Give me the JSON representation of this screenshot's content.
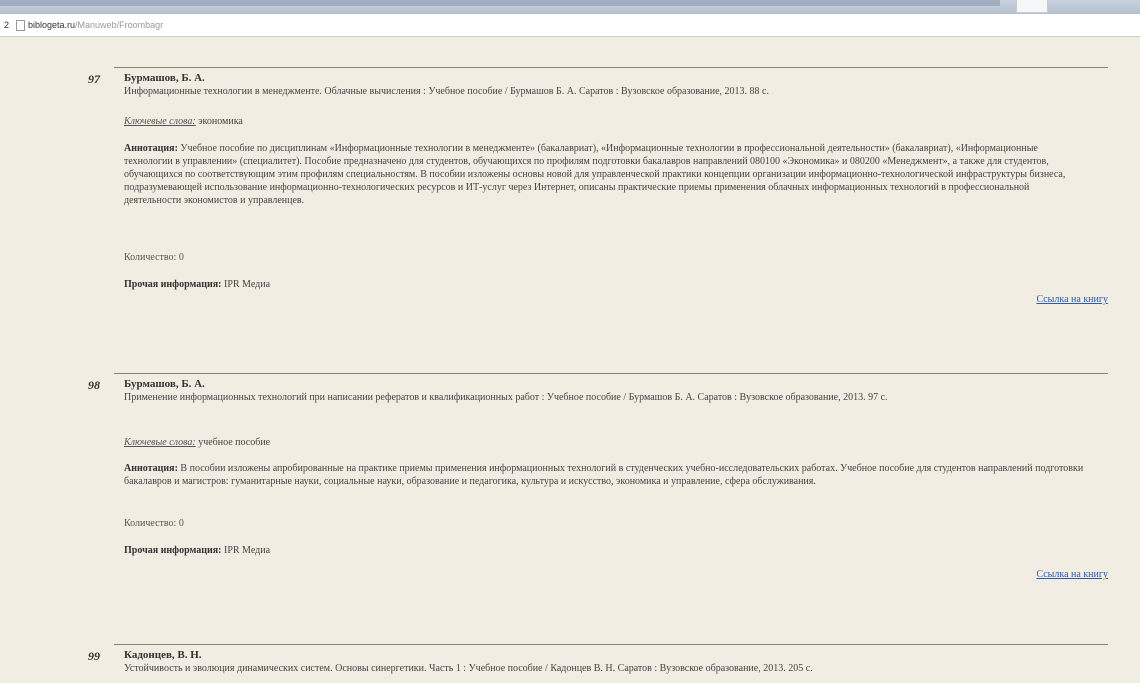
{
  "browser": {
    "tab_number": "2",
    "url_host": "biblogeta.ru",
    "url_path": "/Manuweb/Froombagr"
  },
  "entries": [
    {
      "number": "97",
      "author": "Бурмашов, Б. А.",
      "description": "Информационные технологии в менеджменте. Облачные вычисления : Учебное пособие / Бурмашов Б. А. Саратов : Вузовское образование, 2013. 88 с.",
      "keywords_label": "Ключевые слова:",
      "keywords": "экономика",
      "annotation_label": "Аннотация:",
      "annotation": "Учебное пособие по дисциплинам «Информационные технологии в менеджменте» (бакалавриат), «Информационные технологии в профессиональной деятельности» (бакалавриат), «Информационные технологии в управлении» (специалитет). Пособие предназначено для студентов, обучающихся по профилям подготовки бакалавров направлений 080100 «Экономика» и 080200 «Менеджмент», а также для студентов, обучающихся по соответствующим этим профилям специальностям. В пособии изложены основы новой для управленческой практики концепции организации информационно-технологической инфраструктуры бизнеса, подразумевающей использование информационно-технологических ресурсов и ИТ-услуг через Интернет, описаны практические приемы применения облачных информационных технологий в профессиональной деятельности экономистов и управленцев.",
      "quantity_label": "Количество:",
      "quantity": "0",
      "other_info_label": "Прочая информация:",
      "other_info": "IPR Медиа",
      "link": "Ссылка на книгу"
    },
    {
      "number": "98",
      "author": "Бурмашов, Б. А.",
      "description": "Применение информационных технологий при написании рефератов и квалификационных работ : Учебное пособие / Бурмашов Б. А. Саратов : Вузовское образование, 2013. 97 с.",
      "keywords_label": "Ключевые слова:",
      "keywords": "учебное пособие",
      "annotation_label": "Аннотация:",
      "annotation": "В пособии изложены апробированные на практике приемы применения информационных технологий в студенческих учебно-исследовательских работах. Учебное пособие для студентов направлений подготовки бакалавров и магистров: гуманитарные науки, социальные науки, образование и педагогика, культура и искусство, экономика и управление, сфера обслуживания.",
      "quantity_label": "Количество:",
      "quantity": "0",
      "other_info_label": "Прочая информация:",
      "other_info": "IPR Медиа",
      "link": "Ссылка на книгу"
    },
    {
      "number": "99",
      "author": "Кадонцев, В. Н.",
      "description": "Устойчивость и эволюция динамических систем. Основы синергетики. Часть 1 : Учебное пособие / Кадонцев В. Н. Саратов : Вузовское образование, 2013. 205 с."
    }
  ]
}
